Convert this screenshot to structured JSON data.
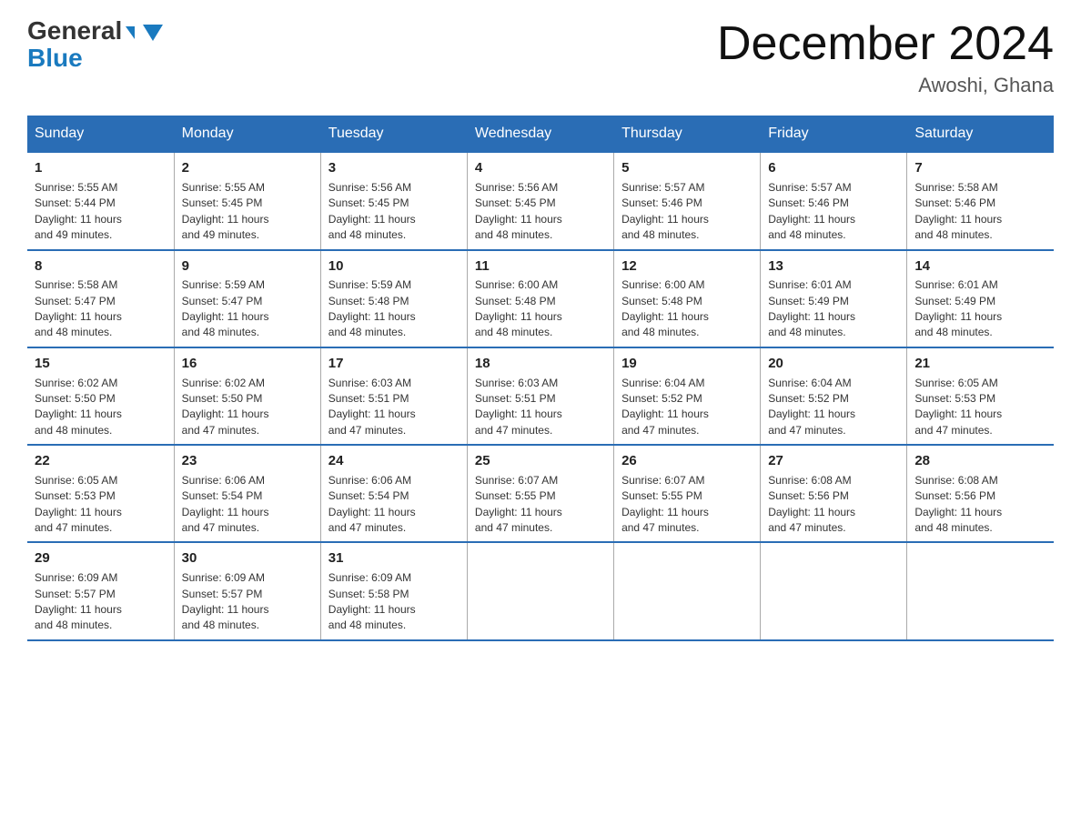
{
  "header": {
    "logo_line1": "General",
    "logo_line2": "Blue",
    "month_title": "December 2024",
    "subtitle": "Awoshi, Ghana"
  },
  "calendar": {
    "days_of_week": [
      "Sunday",
      "Monday",
      "Tuesday",
      "Wednesday",
      "Thursday",
      "Friday",
      "Saturday"
    ],
    "weeks": [
      [
        {
          "day": "1",
          "sunrise": "5:55 AM",
          "sunset": "5:44 PM",
          "daylight": "11 hours and 49 minutes."
        },
        {
          "day": "2",
          "sunrise": "5:55 AM",
          "sunset": "5:45 PM",
          "daylight": "11 hours and 49 minutes."
        },
        {
          "day": "3",
          "sunrise": "5:56 AM",
          "sunset": "5:45 PM",
          "daylight": "11 hours and 48 minutes."
        },
        {
          "day": "4",
          "sunrise": "5:56 AM",
          "sunset": "5:45 PM",
          "daylight": "11 hours and 48 minutes."
        },
        {
          "day": "5",
          "sunrise": "5:57 AM",
          "sunset": "5:46 PM",
          "daylight": "11 hours and 48 minutes."
        },
        {
          "day": "6",
          "sunrise": "5:57 AM",
          "sunset": "5:46 PM",
          "daylight": "11 hours and 48 minutes."
        },
        {
          "day": "7",
          "sunrise": "5:58 AM",
          "sunset": "5:46 PM",
          "daylight": "11 hours and 48 minutes."
        }
      ],
      [
        {
          "day": "8",
          "sunrise": "5:58 AM",
          "sunset": "5:47 PM",
          "daylight": "11 hours and 48 minutes."
        },
        {
          "day": "9",
          "sunrise": "5:59 AM",
          "sunset": "5:47 PM",
          "daylight": "11 hours and 48 minutes."
        },
        {
          "day": "10",
          "sunrise": "5:59 AM",
          "sunset": "5:48 PM",
          "daylight": "11 hours and 48 minutes."
        },
        {
          "day": "11",
          "sunrise": "6:00 AM",
          "sunset": "5:48 PM",
          "daylight": "11 hours and 48 minutes."
        },
        {
          "day": "12",
          "sunrise": "6:00 AM",
          "sunset": "5:48 PM",
          "daylight": "11 hours and 48 minutes."
        },
        {
          "day": "13",
          "sunrise": "6:01 AM",
          "sunset": "5:49 PM",
          "daylight": "11 hours and 48 minutes."
        },
        {
          "day": "14",
          "sunrise": "6:01 AM",
          "sunset": "5:49 PM",
          "daylight": "11 hours and 48 minutes."
        }
      ],
      [
        {
          "day": "15",
          "sunrise": "6:02 AM",
          "sunset": "5:50 PM",
          "daylight": "11 hours and 48 minutes."
        },
        {
          "day": "16",
          "sunrise": "6:02 AM",
          "sunset": "5:50 PM",
          "daylight": "11 hours and 47 minutes."
        },
        {
          "day": "17",
          "sunrise": "6:03 AM",
          "sunset": "5:51 PM",
          "daylight": "11 hours and 47 minutes."
        },
        {
          "day": "18",
          "sunrise": "6:03 AM",
          "sunset": "5:51 PM",
          "daylight": "11 hours and 47 minutes."
        },
        {
          "day": "19",
          "sunrise": "6:04 AM",
          "sunset": "5:52 PM",
          "daylight": "11 hours and 47 minutes."
        },
        {
          "day": "20",
          "sunrise": "6:04 AM",
          "sunset": "5:52 PM",
          "daylight": "11 hours and 47 minutes."
        },
        {
          "day": "21",
          "sunrise": "6:05 AM",
          "sunset": "5:53 PM",
          "daylight": "11 hours and 47 minutes."
        }
      ],
      [
        {
          "day": "22",
          "sunrise": "6:05 AM",
          "sunset": "5:53 PM",
          "daylight": "11 hours and 47 minutes."
        },
        {
          "day": "23",
          "sunrise": "6:06 AM",
          "sunset": "5:54 PM",
          "daylight": "11 hours and 47 minutes."
        },
        {
          "day": "24",
          "sunrise": "6:06 AM",
          "sunset": "5:54 PM",
          "daylight": "11 hours and 47 minutes."
        },
        {
          "day": "25",
          "sunrise": "6:07 AM",
          "sunset": "5:55 PM",
          "daylight": "11 hours and 47 minutes."
        },
        {
          "day": "26",
          "sunrise": "6:07 AM",
          "sunset": "5:55 PM",
          "daylight": "11 hours and 47 minutes."
        },
        {
          "day": "27",
          "sunrise": "6:08 AM",
          "sunset": "5:56 PM",
          "daylight": "11 hours and 47 minutes."
        },
        {
          "day": "28",
          "sunrise": "6:08 AM",
          "sunset": "5:56 PM",
          "daylight": "11 hours and 48 minutes."
        }
      ],
      [
        {
          "day": "29",
          "sunrise": "6:09 AM",
          "sunset": "5:57 PM",
          "daylight": "11 hours and 48 minutes."
        },
        {
          "day": "30",
          "sunrise": "6:09 AM",
          "sunset": "5:57 PM",
          "daylight": "11 hours and 48 minutes."
        },
        {
          "day": "31",
          "sunrise": "6:09 AM",
          "sunset": "5:58 PM",
          "daylight": "11 hours and 48 minutes."
        },
        null,
        null,
        null,
        null
      ]
    ],
    "labels": {
      "sunrise": "Sunrise:",
      "sunset": "Sunset:",
      "daylight": "Daylight:"
    }
  }
}
